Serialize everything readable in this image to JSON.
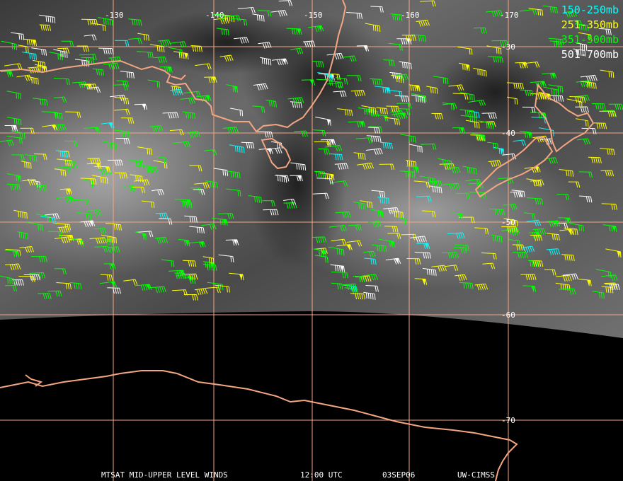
{
  "map": {
    "longitude_labels": [
      "-130",
      "-140",
      "-150",
      "-160",
      "-170"
    ],
    "latitude_labels": [
      "-30",
      "-40",
      "-50",
      "-60",
      "-70"
    ]
  },
  "legend": [
    {
      "label": "150-250mb",
      "color": "#00ffff"
    },
    {
      "label": "251-350mb",
      "color": "#ffff00"
    },
    {
      "label": "351-500mb",
      "color": "#00ff00"
    },
    {
      "label": "501-700mb",
      "color": "#ffffff"
    }
  ],
  "footer": {
    "product": "MTSAT MID-UPPER LEVEL WINDS",
    "time": "12:00 UTC",
    "date": "03SEP06",
    "source": "UW-CIMSS"
  },
  "colors": {
    "grid": "#f4a582",
    "coast": "#f4a582",
    "background": "#000000"
  }
}
